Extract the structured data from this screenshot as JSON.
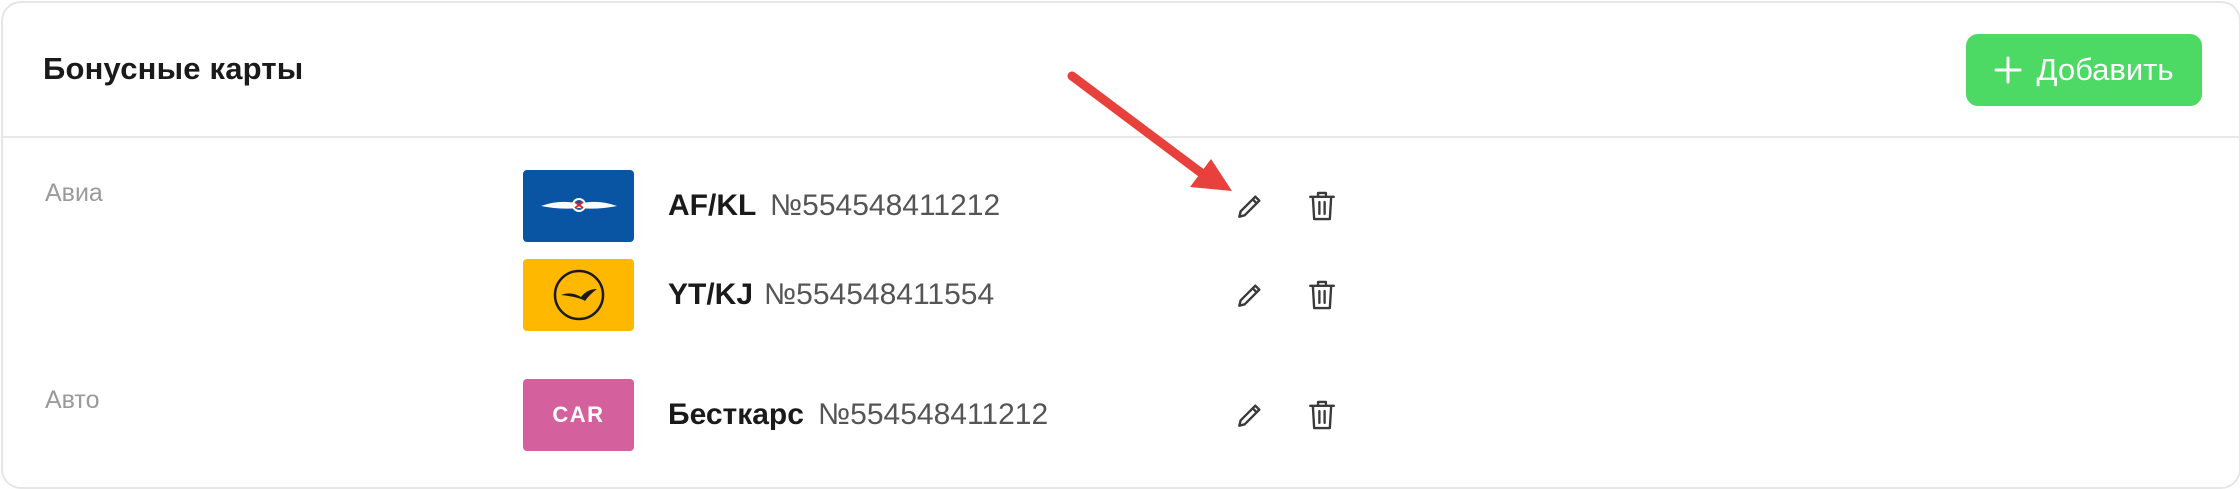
{
  "header": {
    "title": "Бонусные карты",
    "add_label": "Добавить"
  },
  "categories": [
    {
      "label": "Авиа",
      "cards": [
        {
          "logo": "aeroflot-logo",
          "logo_color": "#0a54a4",
          "code": "AF/KL",
          "number": "№554548411212"
        },
        {
          "logo": "lufthansa-logo",
          "logo_color": "#ffb800",
          "code": "YT/KJ",
          "number": "№554548411554"
        }
      ]
    },
    {
      "label": "Авто",
      "cards": [
        {
          "logo": "car-logo",
          "logo_color": "#d4619e",
          "logo_text": "CAR",
          "code": "Бесткарс",
          "number": "№554548411212"
        }
      ]
    }
  ],
  "colors": {
    "accent": "#4cd964",
    "annotation_arrow": "#e8403c"
  }
}
